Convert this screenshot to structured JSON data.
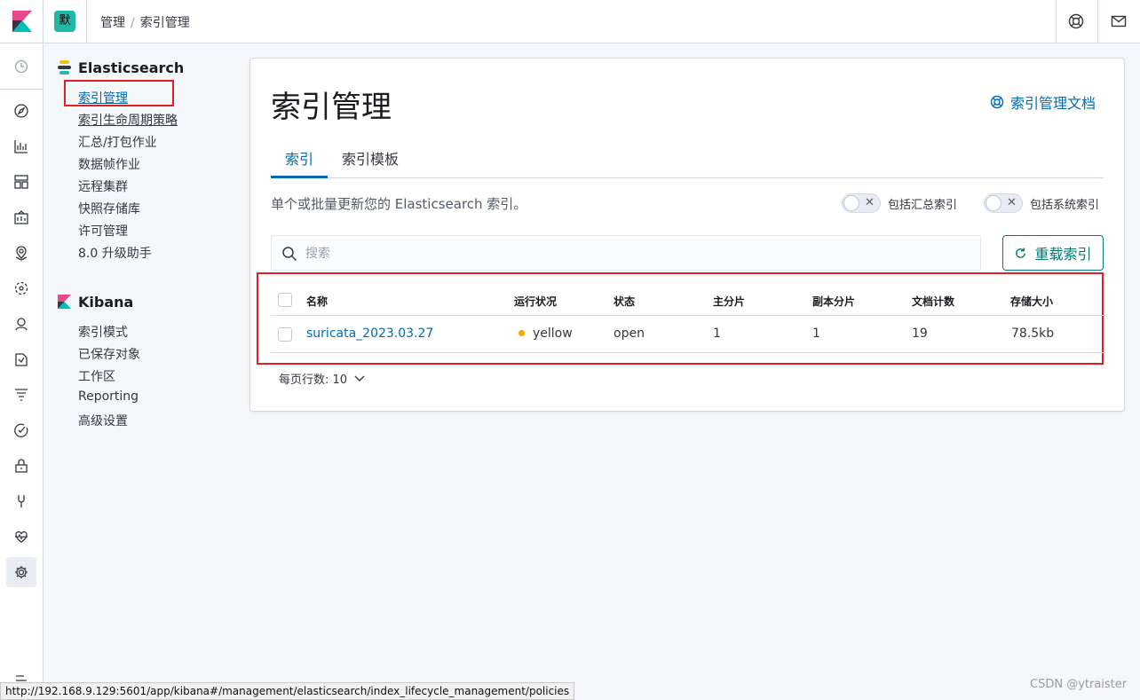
{
  "header": {
    "space_initial": "默",
    "breadcrumbs": [
      "管理",
      "索引管理"
    ]
  },
  "sidebar": {
    "elasticsearch": {
      "title": "Elasticsearch",
      "items": [
        "索引管理",
        "索引生命周期策略",
        "汇总/打包作业",
        "数据帧作业",
        "远程集群",
        "快照存储库",
        "许可管理",
        "8.0 升级助手"
      ]
    },
    "kibana": {
      "title": "Kibana",
      "items": [
        "索引模式",
        "已保存对象",
        "工作区",
        "Reporting",
        "高级设置"
      ]
    }
  },
  "main": {
    "title": "索引管理",
    "doc_link": "索引管理文档",
    "tabs": [
      "索引",
      "索引模板"
    ],
    "description": "单个或批量更新您的 Elasticsearch 索引。",
    "toggles": [
      "包括汇总索引",
      "包括系统索引"
    ],
    "search_placeholder": "搜索",
    "reload_label": "重载索引",
    "table": {
      "headers": [
        "名称",
        "运行状况",
        "状态",
        "主分片",
        "副本分片",
        "文档计数",
        "存储大小"
      ],
      "rows": [
        {
          "name": "suricata_2023.03.27",
          "health": "yellow",
          "status": "open",
          "primary": "1",
          "replicas": "1",
          "docs": "19",
          "size": "78.5kb"
        }
      ]
    },
    "rows_per_page": "每页行数: 10"
  },
  "status_url": "http://192.168.9.129:5601/app/kibana#/management/elasticsearch/index_lifecycle_management/policies",
  "watermark": "CSDN @ytraister",
  "colors": {
    "accent": "#006bb4",
    "health_yellow": "#f5a700",
    "reload": "#017d73",
    "highlight": "#e02020"
  }
}
